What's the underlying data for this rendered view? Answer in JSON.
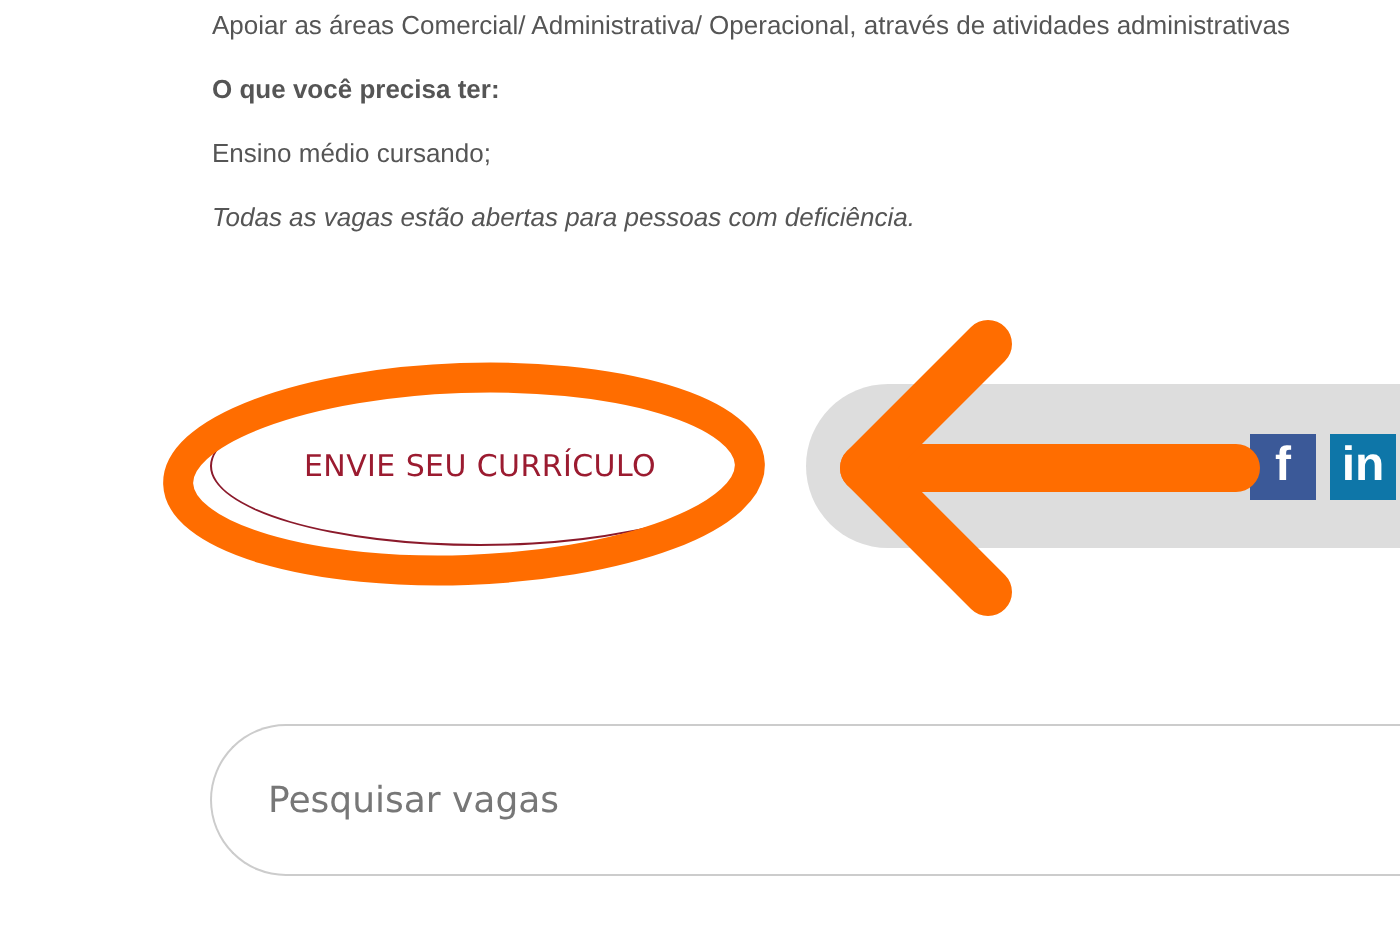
{
  "paragraphs": [
    {
      "kind": "plain",
      "text": "Apoiar as áreas Comercial/ Administrativa/ Operacional, através de atividades administrativas"
    },
    {
      "kind": "bold",
      "text": "O que você precisa ter:"
    },
    {
      "kind": "plain",
      "text": "Ensino médio cursando;"
    },
    {
      "kind": "italic",
      "text": "Todas as vagas estão abertas para pessoas com deficiência."
    }
  ],
  "apply_button": {
    "label": "ENVIE SEU CURRÍCULO"
  },
  "share_bar": {
    "buttons": [
      {
        "kind": "facebook",
        "label": "f"
      },
      {
        "kind": "linkedin",
        "label": "in"
      }
    ]
  },
  "search": {
    "placeholder": "Pesquisar vagas"
  }
}
